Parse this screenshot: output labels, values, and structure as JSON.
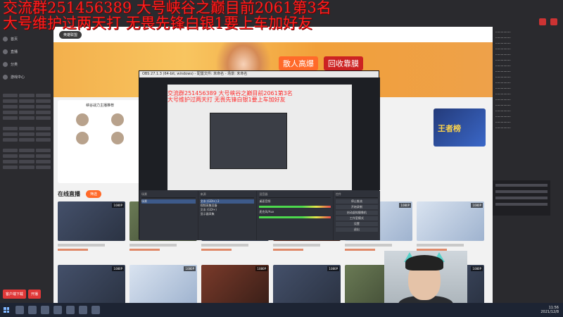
{
  "overlay": {
    "line1": "交流群251456389 大号峡谷之巅目前2061第3名",
    "line2": "大号维护过两天打 无畏先锋白银1要上车加好友"
  },
  "site": {
    "logo": "英雄联盟",
    "banner_text1": "散人高爆",
    "banner_text2": "回收靠膜",
    "anchor_card_title": "峡谷战力主播推荐",
    "promo_text": "王者榜",
    "live_title": "在线直播",
    "live_pill": "筛选",
    "quality_badge": "1080P"
  },
  "sidebar": {
    "nav": [
      "首页",
      "直播",
      "分类",
      "游戏中心"
    ],
    "bottom_buttons": [
      "客户端下载",
      "开播"
    ]
  },
  "obs": {
    "title": "OBS 27.1.3 (64-bit, windows) - 配置文件: 未命名 - 场景: 未命名",
    "preview_overlay_line1": "交流群251456389 大号峡谷之巅目前2061第3名",
    "preview_overlay_line2": "大号维护过两天打 无畏先锋白银1要上车加好友",
    "docks": {
      "scenes_title": "场景",
      "scenes": [
        "场景"
      ],
      "sources_title": "来源",
      "sources": [
        "文本 (GDI+) 2",
        "视频采集设备",
        "文本 (GDI+)",
        "显示器采集"
      ],
      "mixer_title": "混音器",
      "mixer": [
        "桌面音频",
        "麦克风/Aux"
      ],
      "controls_title": "控件",
      "controls": [
        "停止推流",
        "开始录制",
        "启动虚拟摄像机",
        "工作室模式",
        "设置",
        "退出"
      ]
    }
  },
  "taskbar": {
    "time": "11:56",
    "date": "2021/12/8"
  }
}
